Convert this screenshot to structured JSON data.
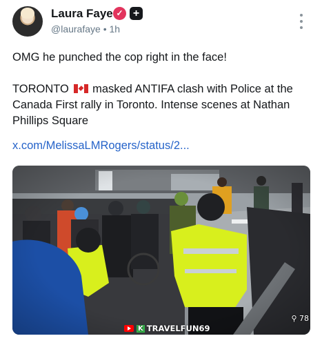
{
  "author": {
    "name": "Laura Faye",
    "handle": "@laurafaye",
    "separator": "•",
    "time": "1h",
    "verified_icon": "check-badge-icon",
    "plus_icon": "plus-badge-icon",
    "verified_glyph": "✓",
    "plus_glyph": "+"
  },
  "post": {
    "line1": "OMG he punched the cop right in the face!",
    "line2_prefix": "TORONTO",
    "line2_suffix": " masked ANTIFA clash with Police at the Canada First rally in Toronto. Intense scenes at Nathan Phillips Square",
    "link": "x.com/MelissaLMRogers/status/2..."
  },
  "media": {
    "watermark_k": "K",
    "watermark_text": "TRAVELFUN69",
    "view_count": "78"
  },
  "colors": {
    "verified": "#e2345d",
    "link": "#2563c9",
    "police_vest": "#d8ef1d"
  }
}
